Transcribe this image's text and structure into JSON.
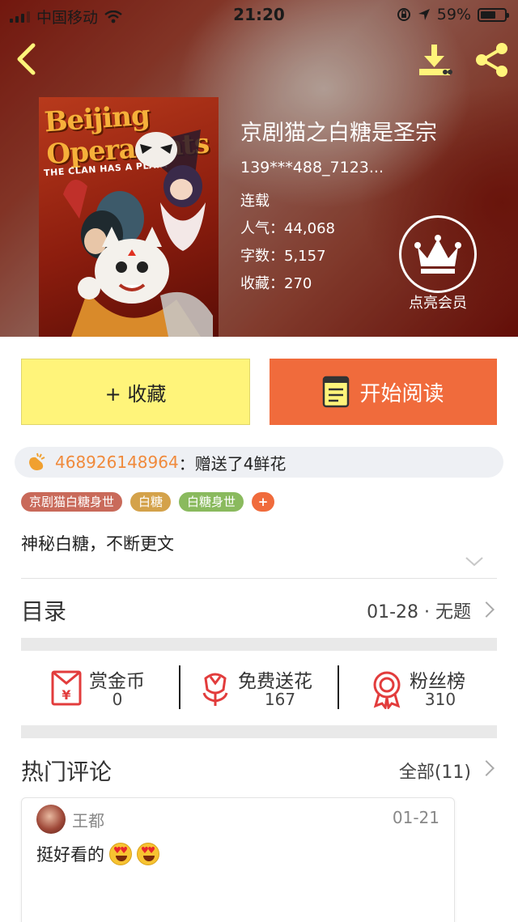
{
  "status_bar": {
    "carrier": "中国移动",
    "time": "21:20",
    "battery": "59%"
  },
  "cover": {
    "title_line": "Beijing Opera Cats",
    "tagline": "THE CLAN HAS A PLAN!"
  },
  "book": {
    "title": "京剧猫之白糖是圣宗",
    "author": "139***488_7123...",
    "status": "连载",
    "popularity": "人气：44,068",
    "word_count": "字数：5,157",
    "favorites": "收藏：270"
  },
  "vip": {
    "label": "点亮会员"
  },
  "actions": {
    "collect_label": "+ 收藏",
    "read_label": "开始阅读"
  },
  "gift": {
    "user": "468926148964",
    "message": "：赠送了4鲜花"
  },
  "tags": [
    {
      "label": "京剧猫白糖身世",
      "color": "#c96a5a"
    },
    {
      "label": "白糖",
      "color": "#d4a24a"
    },
    {
      "label": "白糖身世",
      "color": "#8aba5e"
    },
    {
      "label": "+",
      "color": "#f06b3c"
    }
  ],
  "description": "神秘白糖，不断更文",
  "toc": {
    "heading": "目录",
    "latest": "01-28 · 无题"
  },
  "stats": [
    {
      "label": "赏金币",
      "value": "0"
    },
    {
      "label": "免费送花",
      "value": "167"
    },
    {
      "label": "粉丝榜",
      "value": "310"
    }
  ],
  "hot_comments": {
    "heading": "热门评论",
    "all_label": "全部(11)"
  },
  "comment": {
    "user": "王都",
    "date": "01-21",
    "text": "挺好看的"
  },
  "colors": {
    "accent_orange": "#f06b3c",
    "collect_yellow": "#fff47a",
    "icon_red": "#e23c3c",
    "highlight_user": "#f08a3c"
  }
}
